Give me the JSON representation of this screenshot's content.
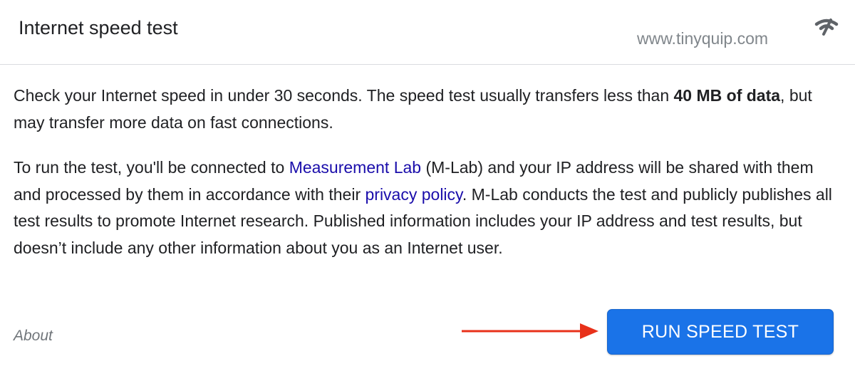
{
  "header": {
    "title": "Internet speed test",
    "site": "www.tinyquip.com",
    "icon": "wifi-signal-icon"
  },
  "body": {
    "p1": {
      "text_before_bold": "Check your Internet speed in under 30 seconds. The speed test usually transfers less than ",
      "bold": "40 MB of data",
      "text_after_bold": ", but may transfer more data on fast connections."
    },
    "p2": {
      "text1": "To run the test, you'll be connected to ",
      "link1": "Measurement Lab",
      "text2": " (M-Lab) and your IP address will be shared with them and processed by them in accordance with their ",
      "link2": "privacy policy",
      "text3": ". M-Lab conducts the test and publicly publishes all test results to promote Internet research. Published information includes your IP address and test results, but doesn’t include any other information about you as an Internet user."
    }
  },
  "footer": {
    "about_label": "About",
    "run_button_label": "RUN SPEED TEST",
    "arrow_icon": "red-arrow-right-icon"
  },
  "colors": {
    "accent": "#1a73e8",
    "link": "#1a0dab",
    "arrow": "#e8311a"
  }
}
